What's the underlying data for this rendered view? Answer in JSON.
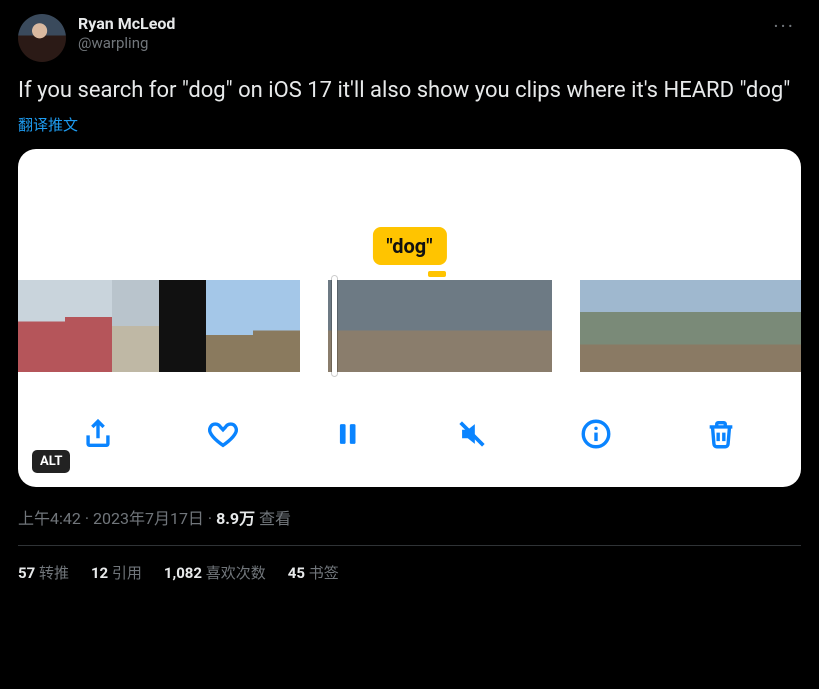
{
  "author": {
    "display_name": "Ryan McLeod",
    "handle": "@warpling"
  },
  "more_glyph": "···",
  "body_text": "If you search for \"dog\" on iOS 17 it'll also show you clips where it's HEARD \"dog\"",
  "translate_label": "翻译推文",
  "media": {
    "search_term": "\"dog\"",
    "alt_badge": "ALT",
    "toolbar_icons": {
      "share": "share-icon",
      "like": "heart-icon",
      "pause": "pause-icon",
      "mute": "speaker-muted-icon",
      "info": "info-icon",
      "trash": "trash-icon"
    }
  },
  "meta": {
    "time": "上午4:42",
    "sep1": " · ",
    "date": "2023年7月17日",
    "sep2": " · ",
    "views_count": "8.9万",
    "views_label": " 查看"
  },
  "stats": {
    "retweets": {
      "count": "57",
      "label": " 转推"
    },
    "quotes": {
      "count": "12",
      "label": " 引用"
    },
    "likes": {
      "count": "1,082",
      "label": " 喜欢次数"
    },
    "bookmarks": {
      "count": "45",
      "label": " 书签"
    }
  }
}
